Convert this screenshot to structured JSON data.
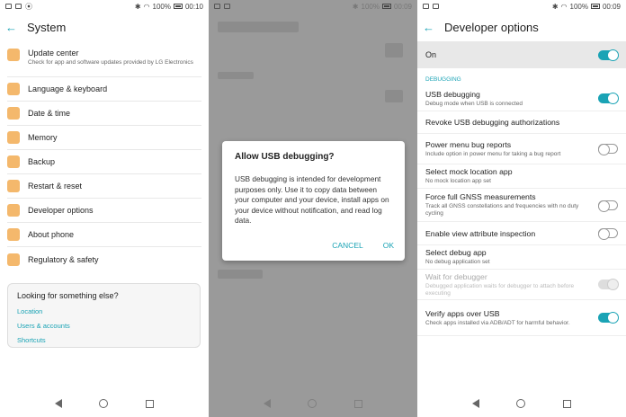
{
  "status_left": {
    "battery_pct": "100%",
    "time": "00:10"
  },
  "status_mid": {
    "battery_pct": "100%",
    "time": "00:09"
  },
  "status_right": {
    "battery_pct": "100%",
    "time": "00:09"
  },
  "system": {
    "title": "System",
    "items": [
      {
        "label": "Update center",
        "sub": "Check for app and software updates provided by LG Electronics"
      },
      {
        "label": "Language & keyboard"
      },
      {
        "label": "Date & time"
      },
      {
        "label": "Memory"
      },
      {
        "label": "Backup"
      },
      {
        "label": "Restart & reset"
      },
      {
        "label": "Developer options"
      },
      {
        "label": "About phone"
      },
      {
        "label": "Regulatory & safety"
      }
    ],
    "card": {
      "title": "Looking for something else?",
      "links": [
        "Location",
        "Users & accounts",
        "Shortcuts"
      ]
    }
  },
  "dialog": {
    "title": "Allow USB debugging?",
    "body": "USB debugging is intended for development purposes only. Use it to copy data between your computer and your device, install apps on your device without notification, and read log data.",
    "cancel": "CANCEL",
    "ok": "OK"
  },
  "dev": {
    "title": "Developer options",
    "on_label": "On",
    "section": "DEBUGGING",
    "rows": [
      {
        "label": "USB debugging",
        "sub": "Debug mode when USB is connected",
        "toggle": "on"
      },
      {
        "label": "Revoke USB debugging authorizations",
        "sub": "",
        "toggle": "none"
      },
      {
        "label": "Power menu bug reports",
        "sub": "Include option in power menu for taking a bug report",
        "toggle": "off"
      },
      {
        "label": "Select mock location app",
        "sub": "No mock location app set",
        "toggle": "none"
      },
      {
        "label": "Force full GNSS measurements",
        "sub": "Track all GNSS constellations and frequencies with no duty cycling",
        "toggle": "off"
      },
      {
        "label": "Enable view attribute inspection",
        "sub": "",
        "toggle": "off"
      },
      {
        "label": "Select debug app",
        "sub": "No debug application set",
        "toggle": "none"
      },
      {
        "label": "Wait for debugger",
        "sub": "Debugged application waits for debugger to attach before executing",
        "toggle": "disabled"
      },
      {
        "label": "Verify apps over USB",
        "sub": "Check apps installed via ADB/ADT for harmful behavior.",
        "toggle": "on"
      }
    ]
  },
  "colors": {
    "accent": "#1aa3b5",
    "icon": "#f4b86c"
  }
}
